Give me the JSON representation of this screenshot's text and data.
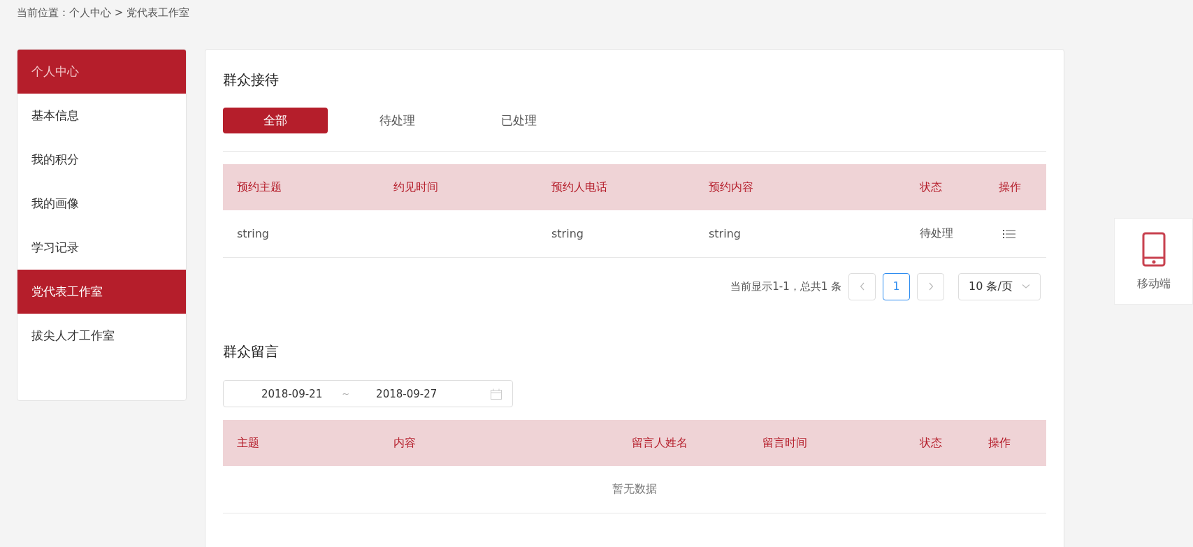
{
  "breadcrumb": "当前位置：个人中心 > 党代表工作室",
  "sidebar": {
    "header": "个人中心",
    "items": [
      {
        "label": "基本信息",
        "selected": false
      },
      {
        "label": "我的积分",
        "selected": false
      },
      {
        "label": "我的画像",
        "selected": false
      },
      {
        "label": "学习记录",
        "selected": false
      },
      {
        "label": "党代表工作室",
        "selected": true
      },
      {
        "label": "拔尖人才工作室",
        "selected": false
      }
    ]
  },
  "reception": {
    "title": "群众接待",
    "tabs": [
      {
        "label": "全部",
        "selected": true
      },
      {
        "label": "待处理",
        "selected": false
      },
      {
        "label": "已处理",
        "selected": false
      }
    ],
    "columns": [
      "预约主题",
      "约见时间",
      "预约人电话",
      "预约内容",
      "状态",
      "操作"
    ],
    "rows": [
      {
        "subject": "string",
        "time": "",
        "phone": "string",
        "content": "string",
        "status": "待处理"
      }
    ],
    "pagination": {
      "summary": "当前显示1-1，总共1 条",
      "pages": [
        {
          "label": "1",
          "selected": true
        }
      ],
      "page_size": "10 条/页"
    }
  },
  "messages": {
    "title": "群众留言",
    "date_range": {
      "start": "2018-09-21",
      "separator": "~",
      "end": "2018-09-27"
    },
    "columns": [
      "主题",
      "内容",
      "留言人姓名",
      "留言时间",
      "状态",
      "操作"
    ],
    "empty_text": "暂无数据"
  },
  "side_widget": {
    "label": "移动端"
  }
}
